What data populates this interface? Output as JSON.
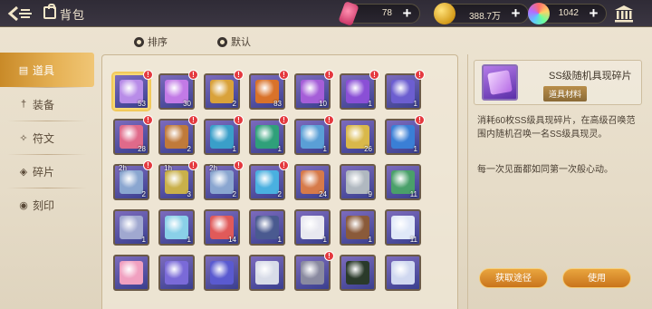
{
  "header": {
    "title": "背包",
    "resources": [
      {
        "icon": "pink-crystal-icon",
        "value": "78"
      },
      {
        "icon": "gold-coin-icon",
        "value": "388.7万"
      },
      {
        "icon": "rainbow-orb-icon",
        "value": "1042"
      }
    ]
  },
  "sortbar": {
    "sort_label": "排序",
    "default_label": "默认"
  },
  "tabs": [
    {
      "label": "道具",
      "icon": "bag-icon",
      "active": true
    },
    {
      "label": "装备",
      "icon": "sword-icon",
      "active": false
    },
    {
      "label": "符文",
      "icon": "rune-icon",
      "active": false
    },
    {
      "label": "碎片",
      "icon": "shard-icon",
      "active": false
    },
    {
      "label": "刻印",
      "icon": "seal-icon",
      "active": false
    }
  ],
  "grid": [
    [
      {
        "count": "53",
        "badge": true,
        "timer": "",
        "color": "#b88ce8"
      },
      {
        "count": "30",
        "badge": true,
        "timer": "",
        "color": "#c27ae6"
      },
      {
        "count": "2",
        "badge": true,
        "timer": "",
        "color": "#d9a23a"
      },
      {
        "count": "83",
        "badge": true,
        "timer": "",
        "color": "#d9722a"
      },
      {
        "count": "10",
        "badge": true,
        "timer": "",
        "color": "#a55ed8"
      },
      {
        "count": "1",
        "badge": true,
        "timer": "",
        "color": "#8a4fd6"
      },
      {
        "count": "1",
        "badge": true,
        "timer": "",
        "color": "#6c5ed0"
      }
    ],
    [
      {
        "count": "28",
        "badge": true,
        "timer": "",
        "color": "#e06a8a"
      },
      {
        "count": "2",
        "badge": true,
        "timer": "",
        "color": "#c07a3a"
      },
      {
        "count": "1",
        "badge": true,
        "timer": "",
        "color": "#3a9fc9"
      },
      {
        "count": "1",
        "badge": true,
        "timer": "",
        "color": "#2fa07a"
      },
      {
        "count": "1",
        "badge": true,
        "timer": "",
        "color": "#5a9fd6"
      },
      {
        "count": "26",
        "badge": false,
        "timer": "",
        "color": "#d9b84a"
      },
      {
        "count": "1",
        "badge": true,
        "timer": "",
        "color": "#3a7fd6"
      }
    ],
    [
      {
        "count": "2",
        "badge": true,
        "timer": "2h",
        "color": "#8aa6d0"
      },
      {
        "count": "3",
        "badge": true,
        "timer": "1h",
        "color": "#c9b04a"
      },
      {
        "count": "2",
        "badge": true,
        "timer": "2h",
        "color": "#8aa6d0"
      },
      {
        "count": "2",
        "badge": true,
        "timer": "",
        "color": "#4ab0e0"
      },
      {
        "count": "24",
        "badge": false,
        "timer": "",
        "color": "#d67a4a"
      },
      {
        "count": "9",
        "badge": false,
        "timer": "",
        "color": "#b0b8c0"
      },
      {
        "count": "11",
        "badge": false,
        "timer": "",
        "color": "#4aa06a"
      }
    ],
    [
      {
        "count": "1",
        "badge": false,
        "timer": "",
        "color": "#a0a8d0"
      },
      {
        "count": "1",
        "badge": false,
        "timer": "",
        "color": "#8ad0e8"
      },
      {
        "count": "14",
        "badge": false,
        "timer": "",
        "color": "#e05a5a"
      },
      {
        "count": "1",
        "badge": false,
        "timer": "",
        "color": "#4a5a90"
      },
      {
        "count": "1",
        "badge": false,
        "timer": "",
        "color": "#e8e8f0"
      },
      {
        "count": "1",
        "badge": false,
        "timer": "",
        "color": "#8a5a3a"
      },
      {
        "count": "11",
        "badge": false,
        "timer": "",
        "color": "#e0e8f8"
      }
    ],
    [
      {
        "count": "",
        "badge": false,
        "timer": "",
        "color": "#f0a0c0"
      },
      {
        "count": "",
        "badge": false,
        "timer": "",
        "color": "#7a6ad8"
      },
      {
        "count": "",
        "badge": false,
        "timer": "",
        "color": "#5a5ad0"
      },
      {
        "count": "",
        "badge": false,
        "timer": "",
        "color": "#d8dce8"
      },
      {
        "count": "",
        "badge": true,
        "timer": "",
        "color": "#8a8aa0"
      },
      {
        "count": "",
        "badge": false,
        "timer": "",
        "color": "#2a3a2a"
      },
      {
        "count": "",
        "badge": false,
        "timer": "",
        "color": "#d0d8f0"
      }
    ]
  ],
  "detail": {
    "name": "SS级随机具现碎片",
    "type": "道具材料",
    "description": "消耗60枚SS级具现碎片，在高级召唤范围内随机召唤一名SS级具现灵。",
    "flavor": "每一次见面都如同第一次般心动。",
    "source_button": "获取途径",
    "use_button": "使用"
  }
}
